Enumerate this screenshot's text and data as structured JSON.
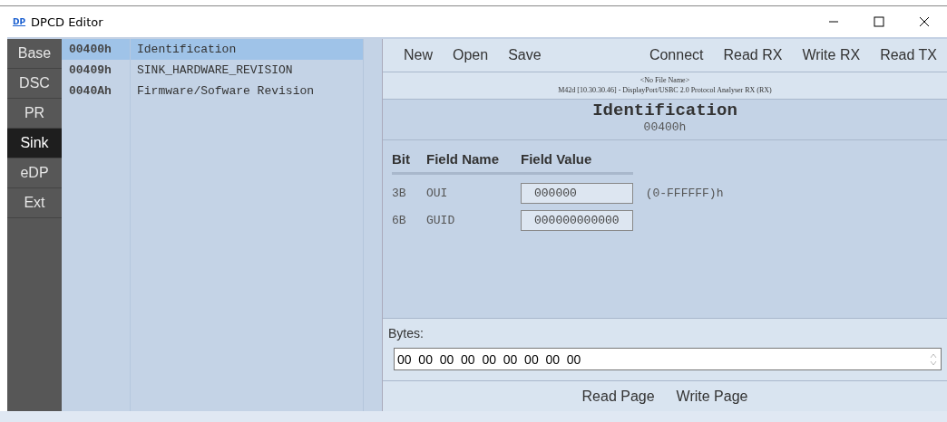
{
  "window": {
    "title": "DPCD Editor",
    "logo": "DP"
  },
  "tabs": [
    {
      "label": "Base",
      "selected": false
    },
    {
      "label": "DSC",
      "selected": false
    },
    {
      "label": "PR",
      "selected": false
    },
    {
      "label": "Sink",
      "selected": true
    },
    {
      "label": "eDP",
      "selected": false
    },
    {
      "label": "Ext",
      "selected": false
    }
  ],
  "registers": [
    {
      "address": "00400h",
      "name": "Identification",
      "selected": true
    },
    {
      "address": "00409h",
      "name": "SINK_HARDWARE_REVISION",
      "selected": false
    },
    {
      "address": "0040Ah",
      "name": "Firmware/Sofware Revision",
      "selected": false
    }
  ],
  "toolbar": {
    "left": [
      "New",
      "Open",
      "Save"
    ],
    "right": [
      "Connect",
      "Read RX",
      "Write RX",
      "Read TX"
    ]
  },
  "info": {
    "file": "<No File Name>",
    "device": "M42d [10.30.30.46] - DisplayPort/USBC 2.0 Protocol Analyser RX  (RX)"
  },
  "page": {
    "title": "Identification",
    "address": "00400h"
  },
  "fields": {
    "columns": [
      "Bit",
      "Field Name",
      "Field Value"
    ],
    "rows": [
      {
        "bit": "3B",
        "name": "OUI",
        "value": "000000",
        "range": "(0-FFFFFF)h"
      },
      {
        "bit": "6B",
        "name": "GUID",
        "value": "000000000000"
      }
    ]
  },
  "bytes": {
    "label": "Bytes:",
    "value": "00  00  00  00  00  00  00  00  00"
  },
  "buttons": [
    "Read Page",
    "Write Page"
  ]
}
